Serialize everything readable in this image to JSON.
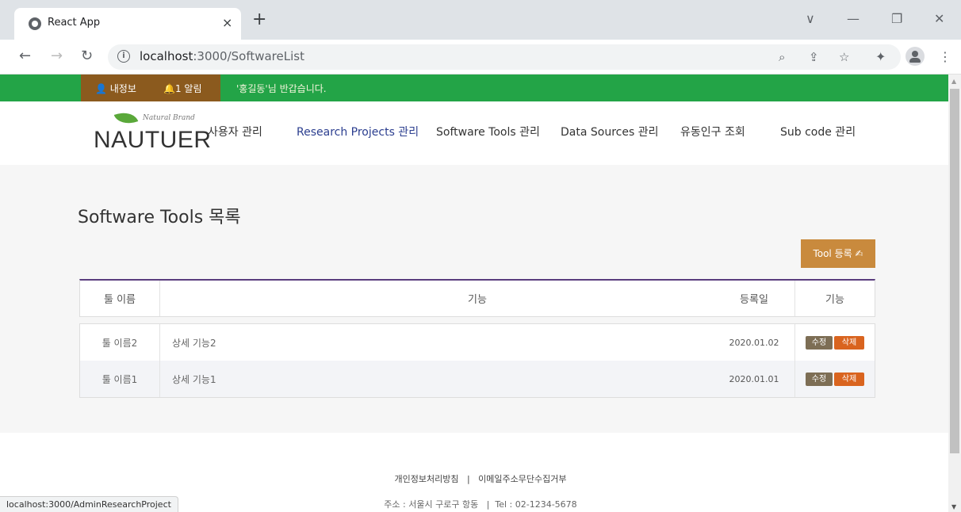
{
  "browser": {
    "tab_title": "React App",
    "tab_close": "×",
    "new_tab": "+",
    "url_host": "localhost",
    "url_path": ":3000/SoftwareList",
    "info_icon": "i",
    "window_controls": [
      "∨",
      "—",
      "❐",
      "✕"
    ]
  },
  "topbar": {
    "my_info": "내정보",
    "alerts": "1 알림",
    "greeting": "'홍길동'님 반갑습니다."
  },
  "header": {
    "logo_small": "Natural Brand",
    "logo_text": "NAUTUER",
    "menu": [
      {
        "label": "사용자 관리"
      },
      {
        "label": "Research Projects 관리"
      },
      {
        "label": "Software Tools 관리"
      },
      {
        "label": "Data Sources 관리"
      },
      {
        "label": "유동인구 조회"
      },
      {
        "label": "Sub code 관리"
      }
    ]
  },
  "page": {
    "title": "Software Tools 목록",
    "register_button": "Tool 등록 ✍"
  },
  "table": {
    "headers": [
      "툴 이름",
      "기능",
      "등록일",
      "기능"
    ],
    "rows": [
      {
        "name": "툴 이름2",
        "desc": "상세 기능2",
        "date": "2020.01.02",
        "edit": "수정",
        "delete": "삭제"
      },
      {
        "name": "툴 이름1",
        "desc": "상세 기능1",
        "date": "2020.01.01",
        "edit": "수정",
        "delete": "삭제"
      }
    ]
  },
  "footer": {
    "privacy": "개인정보처리방침",
    "separator": "|",
    "email_refuse": "이메일주소무단수집거부",
    "address": "주소 : 서울시 구로구 항동   |  Tel : 02-1234-5678"
  },
  "status_url": "localhost:3000/AdminResearchProject",
  "colors": {
    "topbar_green": "#23a447",
    "user_box_brown": "#8b5a1e",
    "active_menu": "#2b3e8f",
    "register_button": "#c98a3d",
    "table_top_border": "#5a3d7e",
    "edit_button": "#7d6e55",
    "delete_button": "#d9641f"
  }
}
